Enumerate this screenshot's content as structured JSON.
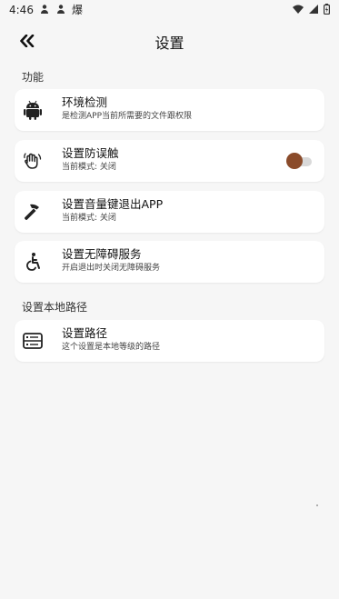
{
  "status_bar": {
    "time": "4:46",
    "notification_icons": [
      "person-icon",
      "person-icon",
      "fire-icon"
    ],
    "extra_glyph": "爆",
    "right_icons": [
      "wifi-icon",
      "signal-icon",
      "battery-icon"
    ]
  },
  "header": {
    "title": "设置",
    "back_icon": "double-chevron-left-icon"
  },
  "sections": {
    "features_label": "功能",
    "paths_label": "设置本地路径"
  },
  "items": {
    "env": {
      "icon": "android-icon",
      "title": "环境检测",
      "subtitle": "是检测APP当前所需要的文件跟权限"
    },
    "anti_touch": {
      "icon": "hand-icon",
      "title": "设置防误触",
      "subtitle": "当前模式: 关闭",
      "toggle_on": false
    },
    "volume_exit": {
      "icon": "hammer-icon",
      "title": "设置音量键退出APP",
      "subtitle": "当前模式: 关闭"
    },
    "accessibility": {
      "icon": "accessibility-icon",
      "title": "设置无障碍服务",
      "subtitle": "开启退出时关闭无障碍服务"
    },
    "path": {
      "icon": "storage-icon",
      "title": "设置路径",
      "subtitle": "这个设置是本地等级的路径"
    }
  },
  "colors": {
    "background": "#f6f6f6",
    "card": "#ffffff",
    "toggle_knob": "#8a4b2a",
    "toggle_track": "#d9d9d9"
  }
}
